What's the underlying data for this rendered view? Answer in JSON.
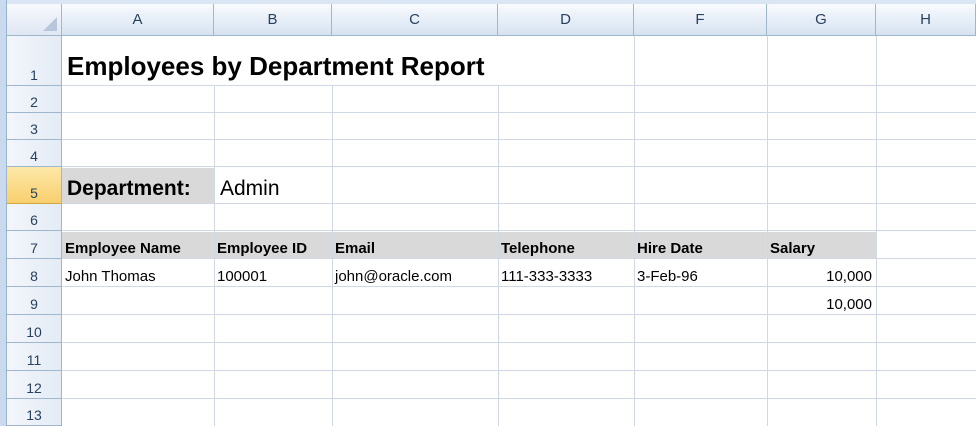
{
  "sheet": {
    "columns": [
      "A",
      "B",
      "C",
      "D",
      "F",
      "G",
      "H"
    ],
    "rows": [
      "1",
      "2",
      "3",
      "4",
      "5",
      "6",
      "7",
      "8",
      "9",
      "10",
      "11",
      "12",
      "13"
    ],
    "active_row": "5"
  },
  "report": {
    "title": "Employees by Department Report",
    "department_label": "Department:",
    "department_value": "Admin"
  },
  "table": {
    "headers": [
      "Employee Name",
      "Employee ID",
      "Email",
      "Telephone",
      "Hire Date",
      "Salary"
    ],
    "rows": [
      [
        "John Thomas",
        "100001",
        "john@oracle.com",
        "111-333-3333",
        "3-Feb-96",
        "10,000"
      ]
    ],
    "total_salary": "10,000"
  },
  "colors": {
    "header_shading": "#d9d9d9",
    "gridline": "#d0d7e5",
    "active_row_header": "#f8cf6e"
  }
}
